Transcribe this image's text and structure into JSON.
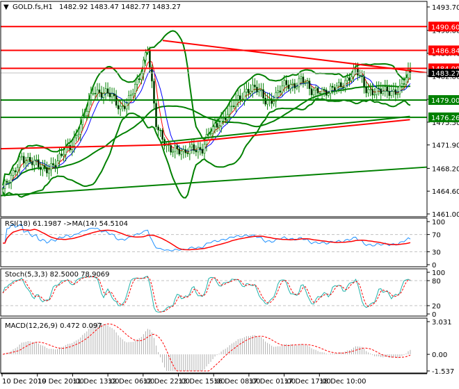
{
  "chart_data": {
    "type": "candlestick",
    "title": "GOLD.fs,H1",
    "ohlc_header": {
      "open": "1482.92",
      "high": "1483.47",
      "low": "1482.77",
      "close": "1483.27"
    },
    "current_price": "1483.27",
    "price_axis": {
      "ylim": [
        1461.0,
        1493.7
      ],
      "ticks": [
        "1493.70",
        "1490.00",
        "1486.40",
        "1482.80",
        "1479.10",
        "1475.50",
        "1471.90",
        "1468.20",
        "1464.60",
        "1461.00"
      ]
    },
    "time_axis": [
      "10 Dec 2019",
      "10 Dec 20:00",
      "11 Dec 13:00",
      "12 Dec 06:00",
      "12 Dec 22:00",
      "13 Dec 15:00",
      "16 Dec 08:00",
      "17 Dec 01:00",
      "17 Dec 17:00",
      "18 Dec 10:00"
    ],
    "close_path": [
      1465,
      1466.5,
      1470.5,
      1469,
      1468.5,
      1468.5,
      1468.7,
      1471.5,
      1473,
      1476,
      1481,
      1480,
      1479.5,
      1478,
      1479,
      1482,
      1488,
      1474,
      1472,
      1471.5,
      1470,
      1472,
      1471,
      1474,
      1476,
      1477,
      1479,
      1481,
      1480.5,
      1479,
      1479.5,
      1481,
      1481.5,
      1482.5,
      1480,
      1481,
      1480,
      1481,
      1482.5,
      1483.5,
      1481,
      1480.5,
      1480,
      1480.5,
      1481,
      1483.3
    ],
    "levels": [
      {
        "price": 1490.6,
        "label": "1490.60",
        "color": "#ff0000"
      },
      {
        "price": 1486.84,
        "label": "1486.84",
        "color": "#ff0000"
      },
      {
        "price": 1484.0,
        "label": "1484.00",
        "color": "#ff0000"
      },
      {
        "price": 1479.0,
        "label": "1479.00",
        "color": "#008000"
      },
      {
        "price": 1476.26,
        "label": "1476.26",
        "color": "#008000"
      }
    ],
    "trendlines": [
      {
        "from": [
          0.38,
          1488.4
        ],
        "to": [
          1.0,
          1483.3
        ],
        "color": "#ff0000"
      },
      {
        "from": [
          0.0,
          1463.9
        ],
        "to": [
          1.0,
          1468.4
        ],
        "color": "#008000"
      },
      {
        "from": [
          0.375,
          1472.3
        ],
        "to": [
          0.96,
          1476.4
        ],
        "color": "#008000"
      },
      {
        "from": [
          0.375,
          1471.9
        ],
        "to": [
          0.96,
          1475.9
        ],
        "color": "#ff0000"
      },
      {
        "from": [
          0.0,
          1471.3
        ],
        "to": [
          0.375,
          1471.9
        ],
        "color": "#ff0000"
      }
    ],
    "indicators": {
      "rsi": {
        "label": "RSI(18) 61.1987  ->MA(14) 54.5104",
        "ticks": [
          "100",
          "70",
          "30",
          "0"
        ],
        "levels": [
          70,
          30
        ]
      },
      "stoch": {
        "label": "Stoch(5,3,3) 82.5000 78.9069",
        "ticks": [
          "100",
          "80",
          "20",
          "0"
        ],
        "levels": [
          80,
          20
        ]
      },
      "macd": {
        "label": "MACD(12,26,9) 0.472 0.097",
        "ticks": [
          "3.031",
          "0.00",
          "-1.537"
        ],
        "range": [
          -1.537,
          3.031
        ]
      }
    },
    "colors": {
      "bull": "#008000",
      "bear": "#008000",
      "rsi": "#1e90ff",
      "signal": "#ff0000",
      "stoch": "#20b2aa",
      "boll": "#008000"
    }
  }
}
